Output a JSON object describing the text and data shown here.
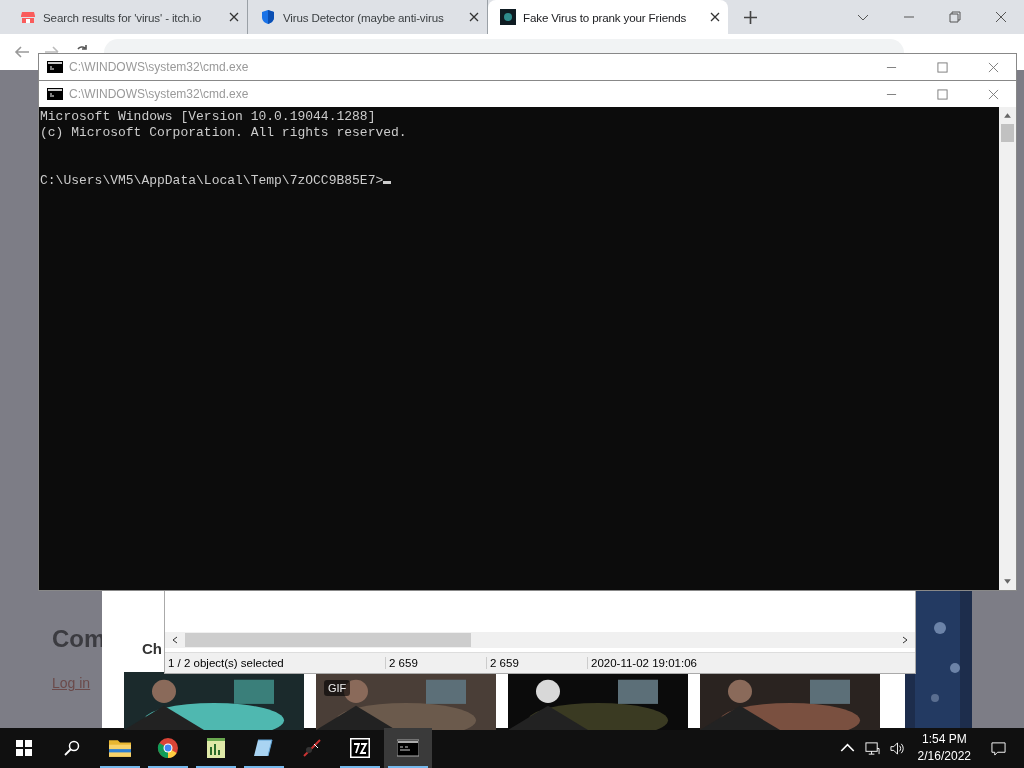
{
  "browser": {
    "tabs": [
      {
        "title": "Search results for 'virus' - itch.io",
        "selected": false
      },
      {
        "title": "Virus Detector (maybe anti-virus",
        "selected": false
      },
      {
        "title": "Fake Virus to prank your Friends",
        "selected": true
      }
    ],
    "page": {
      "heading": "Com",
      "subheading": "Ch",
      "link": "Log in",
      "thumbnails": [
        {
          "kind": "picture"
        },
        {
          "kind": "picture",
          "badge": "GIF"
        },
        {
          "kind": "picture"
        },
        {
          "kind": "picture"
        }
      ]
    }
  },
  "archive_window": {
    "status_bar": [
      "1 / 2 object(s) selected",
      "2 659",
      "2 659",
      "2020-11-02 19:01:06"
    ]
  },
  "console_windows": [
    {
      "title": "C:\\WINDOWS\\system32\\cmd.exe"
    },
    {
      "title": "C:\\WINDOWS\\system32\\cmd.exe",
      "lines": [
        "Microsoft Windows [Version 10.0.19044.1288]",
        "(c) Microsoft Corporation. All rights reserved."
      ],
      "prompt": "C:\\Users\\VM5\\AppData\\Local\\Temp\\7zOCC9B85E7>"
    }
  ],
  "taskbar": {
    "apps": [
      {
        "kind": "folder",
        "running": true,
        "selected": false
      },
      {
        "kind": "chrome",
        "running": true,
        "selected": false
      },
      {
        "kind": "notepad",
        "running": true,
        "selected": false
      },
      {
        "kind": "notebook",
        "running": true,
        "selected": false
      },
      {
        "kind": "virus",
        "running": false,
        "selected": false
      },
      {
        "kind": "sevenzip",
        "running": true,
        "selected": false
      },
      {
        "kind": "console",
        "running": true,
        "selected": true
      }
    ],
    "time": "1:54 PM",
    "date": "2/16/2022"
  }
}
